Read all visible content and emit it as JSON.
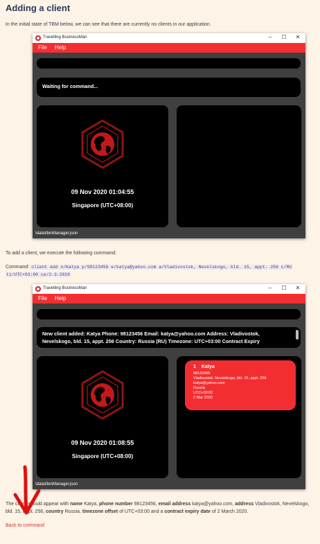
{
  "heading": "Adding a client",
  "intro": "In the initial state of TBM below, we can see that there are currently no clients in our application.",
  "app": {
    "title": "Travelling BusinessMan",
    "menu": [
      "File",
      "Help"
    ],
    "status_path": "\\data\\tbmManager.json",
    "colors": {
      "accent": "#f32e30",
      "panel": "#000000",
      "window_bg": "#3f3f3f"
    },
    "logo_icon": "globe-hexagon-icon"
  },
  "window1": {
    "result_text": "Waiting for command...",
    "clock": "09 Nov 2020 01:04:55",
    "timezone": "Singapore (UTC+08:00)"
  },
  "step_text": "To add a client, we execute the following command:",
  "command_label": "Command:",
  "command_line1": "client add n/Katya p/98123456 e/katya@yahoo.com a/Vladivostok, Nevelskogo, bld. 15, appt. 256 c/RU",
  "command_line2": "tz/UTC+03:00 ce/2-3-2020",
  "window2": {
    "result_line1": "New client added: Katya Phone: 98123456 Email: katya@yahoo.com Address: Vladivostok,",
    "result_line2": "Nevelskogo, bld. 15, appt. 256 Country: Russia (RU) Timezone: UTC+03:00 Contract Expiry",
    "clock": "09 Nov 2020 01:08:55",
    "timezone": "Singapore (UTC+08:00)",
    "client_card": {
      "index": "1",
      "name": "Katya",
      "phone": "98123456",
      "address": "Vladivostok, Nevelskogo, bld. 15, appt. 256",
      "email": "katya@yahoo.com",
      "country": "Russia",
      "timezone": "UTC+03:00",
      "contract_expiry": "2 Mar 2020"
    }
  },
  "summary": {
    "p1": "The client should appear with ",
    "b_name": "name",
    "v_name": " Katya, ",
    "b_phone": "phone number",
    "v_phone": " 98123456, ",
    "b_email": "email address",
    "v_email": " katya@yahoo.com, ",
    "b_address": "address",
    "v_address": " Vladivostok, Nevelskogo, bld. 15, appt. 256, ",
    "b_country": "country",
    "v_country": " Russia, ",
    "b_tz": "timezone offset",
    "v_tz": " of UTC+03:00 and a ",
    "b_contract": "contract expiry date",
    "v_contract": " of 2 March 2020."
  },
  "back_link": "Back to command"
}
